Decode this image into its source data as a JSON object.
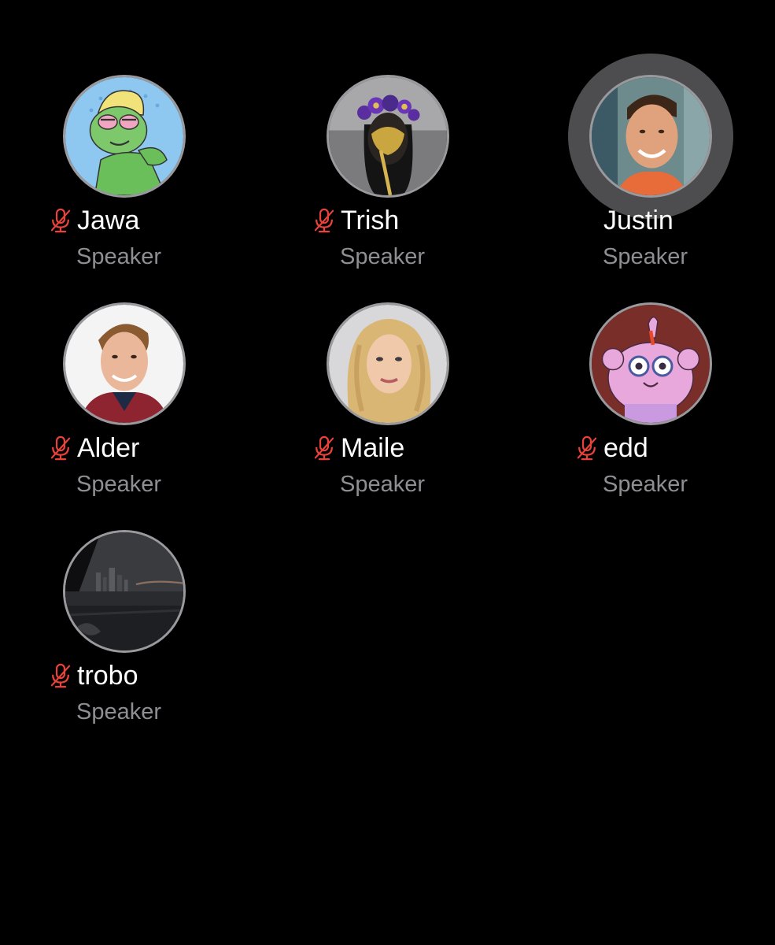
{
  "speakers": [
    {
      "name": "Jawa",
      "role": "Speaker",
      "muted": true,
      "speaking": false,
      "avatar": "cartoon-green-creature-avatar"
    },
    {
      "name": "Trish",
      "role": "Speaker",
      "muted": true,
      "speaking": false,
      "avatar": "gold-mask-flower-crown-avatar"
    },
    {
      "name": "Justin",
      "role": "Speaker",
      "muted": false,
      "speaking": true,
      "avatar": "smiling-man-photo-avatar"
    },
    {
      "name": "Alder",
      "role": "Speaker",
      "muted": true,
      "speaking": false,
      "avatar": "young-man-red-hoodie-photo-avatar"
    },
    {
      "name": "Maile",
      "role": "Speaker",
      "muted": true,
      "speaking": false,
      "avatar": "blonde-woman-photo-avatar"
    },
    {
      "name": "edd",
      "role": "Speaker",
      "muted": true,
      "speaking": false,
      "avatar": "pink-cartoon-character-avatar"
    },
    {
      "name": "trobo",
      "role": "Speaker",
      "muted": true,
      "speaking": false,
      "avatar": "night-city-skyline-photo-avatar"
    }
  ],
  "icons": {
    "muted": "microphone-slash-icon"
  },
  "colors": {
    "background": "#000000",
    "name_text": "#ffffff",
    "role_text": "#8e8e93",
    "muted_icon": "#e8423a",
    "speaking_ring": "#4d4d4f",
    "avatar_border": "#9a9a9e"
  }
}
